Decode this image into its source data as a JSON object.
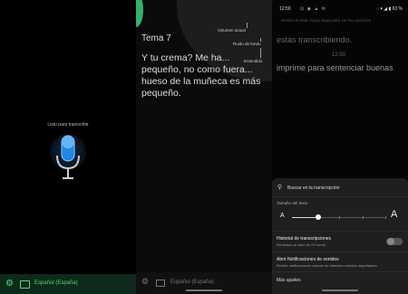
{
  "panel1": {
    "ready_label": "Listo para transcribir",
    "language": "Español (España)",
    "icons": [
      "gear-icon",
      "keyboard-icon",
      "microphone-icon"
    ],
    "accent_color": "#4ade80",
    "mic_color": "#1e88e5"
  },
  "panel2": {
    "title": "Tema 7",
    "transcript": "Y tu crema? Me ha... pequeño, no como fuera... hueso de la muñeca es más pequeño.",
    "callouts": {
      "volume": "Volumen actual",
      "noise": "Ruido de fondo",
      "understood": "Entendido"
    },
    "language": "Español (España)"
  },
  "panel3": {
    "status": {
      "time": "12:50",
      "icons": "⊡ ◉ ▲ ✉",
      "battery": "◌ ▾ ◢ ▮ 63 %"
    },
    "faded_text": "Desliza el dedo hacia abajo para ver las opciones",
    "line1": "estas transcribiendo.",
    "timestamp": "12:50",
    "line2": "imprime para sentenciar buenas",
    "sheet": {
      "search": "Buscar en la transcripción",
      "text_size_label": "Tamaño del texto",
      "size_small": "A",
      "size_big": "A",
      "text_size_level": 0.25,
      "history_title": "Historial de transcripciones",
      "history_sub": "Eliminado al cabo de 24 horas",
      "history_enabled": false,
      "notif_title": "Abrir Notificaciones de sonidos",
      "notif_sub": "Recibe notificaciones cuando se detecten sonidos importantes",
      "more": "Más ajustes"
    }
  }
}
